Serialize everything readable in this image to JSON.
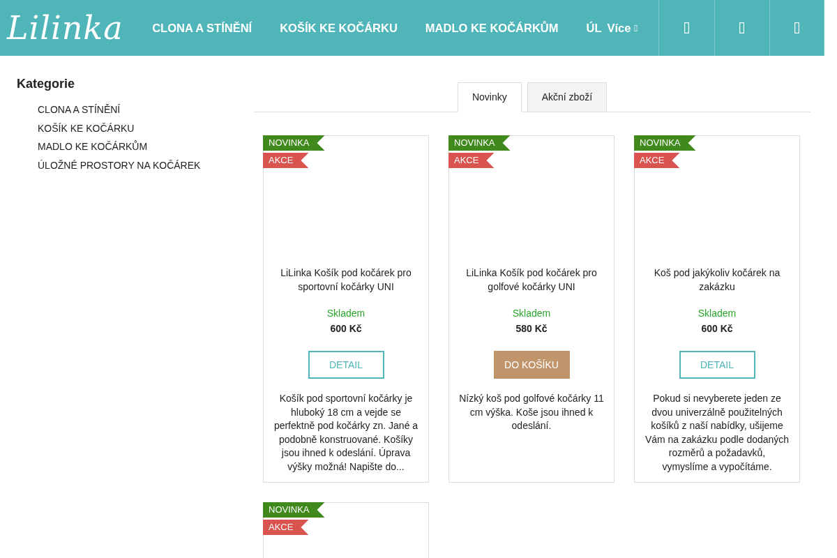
{
  "header": {
    "logo": "Lilinka",
    "nav": [
      "CLONA A STÍNĚNÍ",
      "KOŠÍK KE KOČÁRKU",
      "MADLO KE KOČÁRKŮM",
      "ÚL"
    ],
    "more": "Více",
    "icon_buttons": [
      {
        "kind": "glyph"
      },
      {
        "kind": "glyph"
      },
      {
        "kind": "glyph"
      }
    ]
  },
  "sidebar": {
    "title": "Kategorie",
    "items": [
      "CLONA A STÍNĚNÍ",
      "KOŠÍK KE KOČÁRKU",
      "MADLO KE KOČÁRKŮM",
      "ÚLOŽNÉ PROSTORY NA KOČÁREK"
    ]
  },
  "tabs": [
    {
      "label": "Novinky",
      "selected": true
    },
    {
      "label": "Akční zboží",
      "selected": false
    }
  ],
  "products": [
    {
      "badges": [
        {
          "label": "NOVINKA",
          "kind": "new"
        },
        {
          "label": "AKCE",
          "kind": "sale"
        }
      ],
      "title": "LiLinka Košík pod kočárek pro sportovní kočárky UNI",
      "stock": "Skladem",
      "price": "600 Kč",
      "button": {
        "label": "DETAIL",
        "kind": "detail"
      },
      "description": "Košík pod sportovní kočárky je hluboký 18 cm a vejde se perfektně pod kočárky zn. Jané a podobně konstruované. Košíky jsou ihned k odeslání. Úprava výšky možná! Napište do..."
    },
    {
      "badges": [
        {
          "label": "NOVINKA",
          "kind": "new"
        },
        {
          "label": "AKCE",
          "kind": "sale"
        }
      ],
      "title": "LiLinka Košík pod kočárek pro golfové kočárky UNI",
      "stock": "Skladem",
      "price": "580 Kč",
      "button": {
        "label": "DO KOŠÍKU",
        "kind": "cart"
      },
      "description": "Nízký koš pod golfové kočárky 11 cm výška.  Koše jsou ihned k odeslání."
    },
    {
      "badges": [
        {
          "label": "NOVINKA",
          "kind": "new"
        },
        {
          "label": "AKCE",
          "kind": "sale"
        }
      ],
      "title": "Koš pod jakýkoliv kočárek na zakázku",
      "stock": "Skladem",
      "price": "600 Kč",
      "button": {
        "label": "DETAIL",
        "kind": "detail"
      },
      "description": "Pokud si nevyberete jeden ze dvou univerzálně použitelných košíků z naší nabídky, ušijeme Vám na zakázku podle dodaných rozměrů a požadavků, vymyslíme a vypočítáme."
    },
    {
      "badges": [
        {
          "label": "NOVINKA",
          "kind": "new"
        },
        {
          "label": "AKCE",
          "kind": "sale"
        }
      ]
    }
  ]
}
